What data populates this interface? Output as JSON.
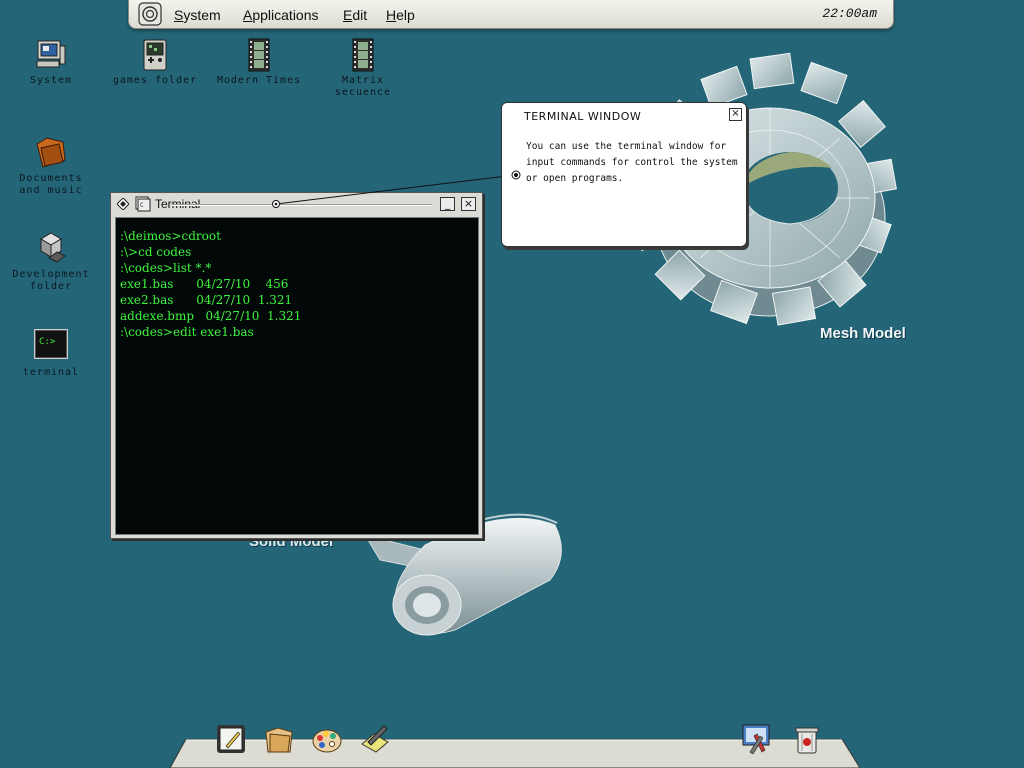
{
  "menubar": {
    "items": [
      "System",
      "Applications",
      "Edit",
      "Help"
    ],
    "clock": "22:00am"
  },
  "desktop_icons": [
    {
      "label": "System",
      "icon": "computer-icon"
    },
    {
      "label": "games folder",
      "icon": "game-console-icon"
    },
    {
      "label": "Modern Times",
      "icon": "film-icon"
    },
    {
      "label": "Matrix\nsecuence",
      "icon": "film-icon"
    },
    {
      "label": "Documents\nand music",
      "icon": "folder-icon"
    },
    {
      "label": "Development\nfolder",
      "icon": "shapes-icon"
    },
    {
      "label": "terminal",
      "icon": "terminal-icon",
      "glyph": "C:>"
    }
  ],
  "models": {
    "mesh_label": "Mesh Model",
    "solid_label": "Solid Model"
  },
  "callout": {
    "title": "TERMINAL WINDOW",
    "close": "×",
    "body": "You can use the terminal window for input commands for control the system or open programs."
  },
  "terminal": {
    "title": "Terminal",
    "minimize": "_",
    "close": "×",
    "lines": [
      ":\\deimos>cdroot",
      ":\\>cd codes",
      ":\\codes>list *.*",
      "exe1.bas      04/27/10    456",
      "exe2.bas      04/27/10  1.321",
      "addexe.bmp   04/27/10  1.321",
      ":\\codes>edit exe1.bas"
    ]
  },
  "dock": {
    "items": [
      "notepad-icon",
      "folders-icon",
      "paint-palette-icon",
      "edit-tool-icon",
      "tools-icon",
      "trash-icon"
    ]
  },
  "colors": {
    "desktop": "#246677",
    "terminal_text": "#3ef43e",
    "terminal_bg": "#020808"
  }
}
